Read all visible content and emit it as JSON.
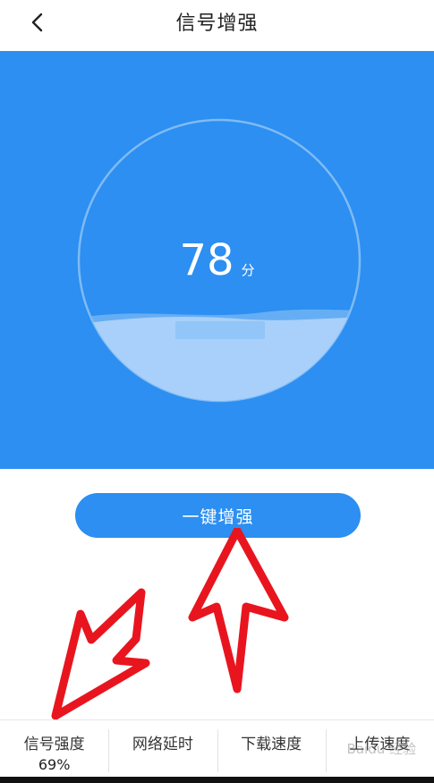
{
  "header": {
    "title": "信号增强",
    "back_icon": "chevron-left-icon"
  },
  "gauge": {
    "score": "78",
    "unit": "分",
    "fill_level": 0.35,
    "colors": {
      "background": "#2c8ff1",
      "ring": "#7fbbf5",
      "water": "#a9d0fa"
    }
  },
  "actions": {
    "boost_label": "一键增强"
  },
  "stats": [
    {
      "label": "信号强度",
      "value": "69%"
    },
    {
      "label": "网络延时",
      "value": ""
    },
    {
      "label": "下载速度",
      "value": ""
    },
    {
      "label": "上传速度",
      "value": ""
    }
  ],
  "annotation_color": "#e8151f",
  "watermark": "Baidu 经验"
}
